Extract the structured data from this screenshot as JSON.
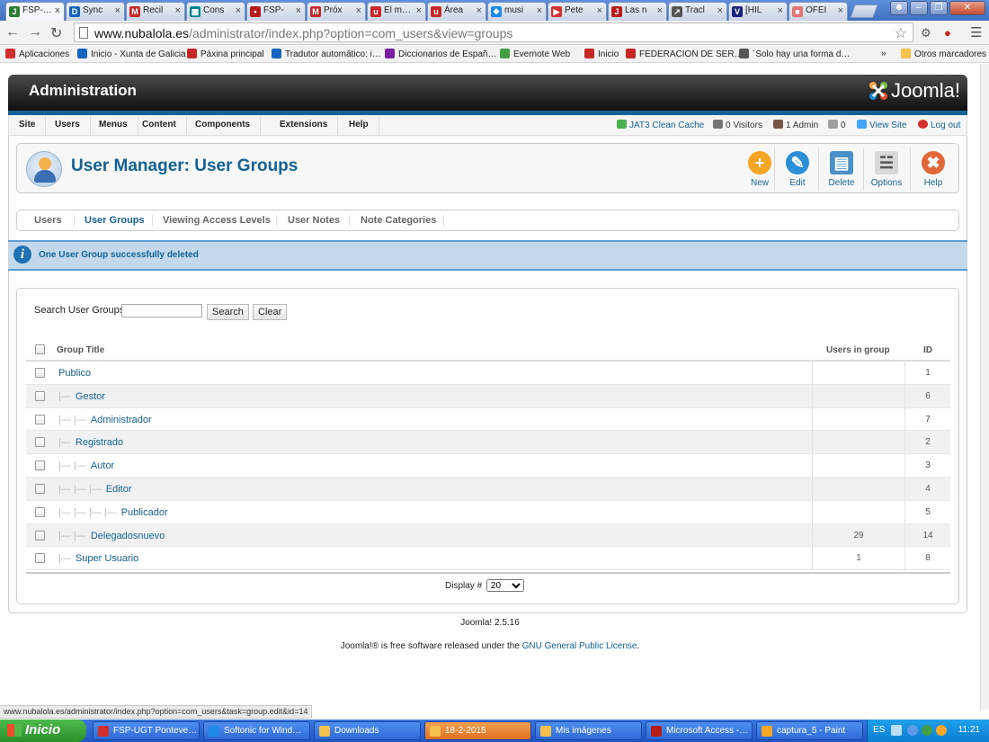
{
  "browser": {
    "tabs": [
      {
        "label": "FSP-…",
        "color": "#2e7d32",
        "glyph": "J",
        "active": true
      },
      {
        "label": "Sync",
        "color": "#1565c0",
        "glyph": "D"
      },
      {
        "label": "Recil",
        "color": "#c62828",
        "glyph": "M"
      },
      {
        "label": "Cons",
        "color": "#00838f",
        "glyph": "▦"
      },
      {
        "label": "FSP-",
        "color": "#b71c1c",
        "glyph": "•"
      },
      {
        "label": "Próx",
        "color": "#c62828",
        "glyph": "M"
      },
      {
        "label": "El m…",
        "color": "#c62828",
        "glyph": "u"
      },
      {
        "label": "Área",
        "color": "#c62828",
        "glyph": "u"
      },
      {
        "label": "musi",
        "color": "#1e88e5",
        "glyph": "❖"
      },
      {
        "label": "Pete",
        "color": "#d32f2f",
        "glyph": "▶"
      },
      {
        "label": "Las n",
        "color": "#b71c1c",
        "glyph": "J"
      },
      {
        "label": "Tracl",
        "color": "#555555",
        "glyph": "↗"
      },
      {
        "label": "[HIL",
        "color": "#1a237e",
        "glyph": "V"
      },
      {
        "label": "OFEI",
        "color": "#e57373",
        "glyph": "■"
      }
    ],
    "url_host": "www.nubalola.es",
    "url_rest": "/administrator/index.php?option=com_users&view=groups",
    "bookmarks": [
      {
        "label": "Aplicaciones",
        "color": "#d32f2f"
      },
      {
        "label": "Inicio - Xunta de Galicia",
        "color": "#1565c0"
      },
      {
        "label": "Páxina principal",
        "color": "#c62828"
      },
      {
        "label": "Tradutor automático: i…",
        "color": "#1565c0"
      },
      {
        "label": "Diccionarios de Españ…",
        "color": "#7b1fa2"
      },
      {
        "label": "Evernote Web",
        "color": "#43a047"
      },
      {
        "label": "Inicio",
        "color": "#c62828"
      },
      {
        "label": "FEDERACION DE SER…",
        "color": "#c62828"
      },
      {
        "label": "´Solo hay una forma d…",
        "color": "#555555"
      }
    ],
    "bookmarks_more": "»",
    "other_bookmarks": "Otros marcadores",
    "status_url": "www.nubalola.es/administrator/index.php?option=com_users&task=group.edit&id=14"
  },
  "header": {
    "title": "Administration",
    "logo_text": "Joomla!"
  },
  "menu": {
    "items": [
      "Site",
      "Users",
      "Menus",
      "Content",
      "Components",
      "Extensions",
      "Help"
    ]
  },
  "status_bar": {
    "cache": "JAT3 Clean Cache",
    "visitors": "0 Visitors",
    "admins": "1 Admin",
    "messages": "0",
    "view_site": "View Site",
    "logout": "Log out"
  },
  "toolbar": {
    "page_title": "User Manager: User Groups",
    "buttons": [
      {
        "label": "New",
        "color": "#f5a623",
        "glyph": "+"
      },
      {
        "label": "Edit",
        "color": "#2a8fd6",
        "glyph": "✎"
      },
      {
        "label": "Delete",
        "color": "#4a90c8",
        "glyph": "▤"
      },
      {
        "label": "Options",
        "color": "#d8d8d8",
        "glyph": "☱"
      },
      {
        "label": "Help",
        "color": "#e2673a",
        "glyph": "✖"
      }
    ]
  },
  "subnav": {
    "items": [
      "Users",
      "User Groups",
      "Viewing Access Levels",
      "User Notes",
      "Note Categories"
    ],
    "active": "User Groups"
  },
  "message": {
    "text": "One User Group successfully deleted"
  },
  "filter": {
    "label": "Search User Groups",
    "value": "",
    "search_button": "Search",
    "clear_button": "Clear"
  },
  "table": {
    "headers": {
      "title": "Group Title",
      "users": "Users in group",
      "id": "ID"
    },
    "rows": [
      {
        "title": "Publico",
        "level": 0,
        "users": "",
        "id": "1"
      },
      {
        "title": "Gestor",
        "level": 1,
        "users": "",
        "id": "6"
      },
      {
        "title": "Administrador",
        "level": 2,
        "users": "",
        "id": "7"
      },
      {
        "title": "Registrado",
        "level": 1,
        "users": "",
        "id": "2"
      },
      {
        "title": "Autor",
        "level": 2,
        "users": "",
        "id": "3"
      },
      {
        "title": "Editor",
        "level": 3,
        "users": "",
        "id": "4"
      },
      {
        "title": "Publicador",
        "level": 4,
        "users": "",
        "id": "5"
      },
      {
        "title": "Delegadosnuevo",
        "level": 2,
        "users": "29",
        "id": "14"
      },
      {
        "title": "Super Usuario",
        "level": 1,
        "users": "1",
        "id": "8"
      }
    ],
    "display_label": "Display #",
    "display_value": "20"
  },
  "footer": {
    "version": "Joomla! 2.5.16",
    "license_prefix": "Joomla!® is free software released under the ",
    "license_link": "GNU General Public License",
    "license_suffix": "."
  },
  "taskbar": {
    "start": "Inicio",
    "tasks": [
      {
        "label": "FSP-UGT Ponteve…",
        "color": "#d32f2f",
        "active": false
      },
      {
        "label": "Softonic for Wind…",
        "color": "#1e88e5",
        "active": false
      },
      {
        "label": "Downloads",
        "color": "#f6c04d",
        "active": false
      },
      {
        "label": "18-2-2015",
        "color": "#f6c04d",
        "active": true
      },
      {
        "label": "Mis imágenes",
        "color": "#f6c04d",
        "active": false
      },
      {
        "label": "Microsoft Access -…",
        "color": "#b71c1c",
        "active": false
      },
      {
        "label": "captura_5 - Paint",
        "color": "#f5a623",
        "active": false
      }
    ],
    "lang": "ES",
    "time": "11:21"
  }
}
